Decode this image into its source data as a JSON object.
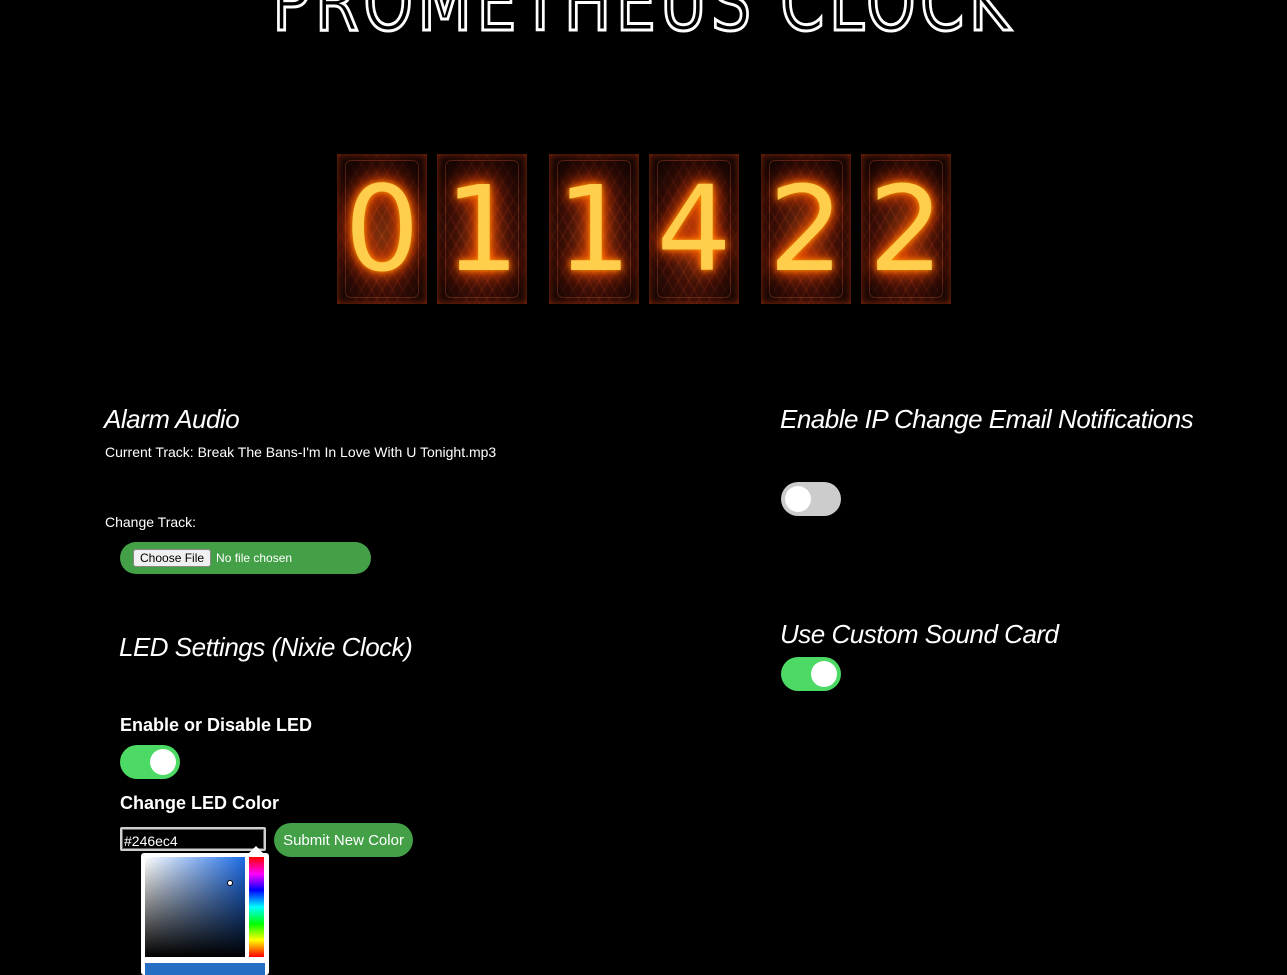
{
  "title": "PROMETHEUS CLOCK",
  "clock": {
    "digits": [
      "0",
      "1",
      "1",
      "4",
      "2",
      "2"
    ]
  },
  "alarm": {
    "heading": "Alarm Audio",
    "current_track": "Current Track: Break The Bans-I'm In Love With U Tonight.mp3",
    "change_track_label": "Change Track:",
    "choose_file_label": "Choose File",
    "no_file_text": "No file chosen"
  },
  "led": {
    "heading": "LED Settings (Nixie Clock)",
    "enable_label": "Enable or Disable LED",
    "enable_on": true,
    "color_label": "Change LED Color",
    "color_value": "#246ec4",
    "submit_label": "Submit New Color"
  },
  "ip_notifications": {
    "heading": "Enable IP Change Email Notifications",
    "enabled": false
  },
  "sound_card": {
    "heading": "Use Custom Sound Card",
    "enabled": true
  },
  "colors": {
    "background": "#000000",
    "toggle_on": "#4cd964",
    "toggle_off": "#cccccc",
    "button_green": "#43a047",
    "led_color": "#246ec4"
  }
}
